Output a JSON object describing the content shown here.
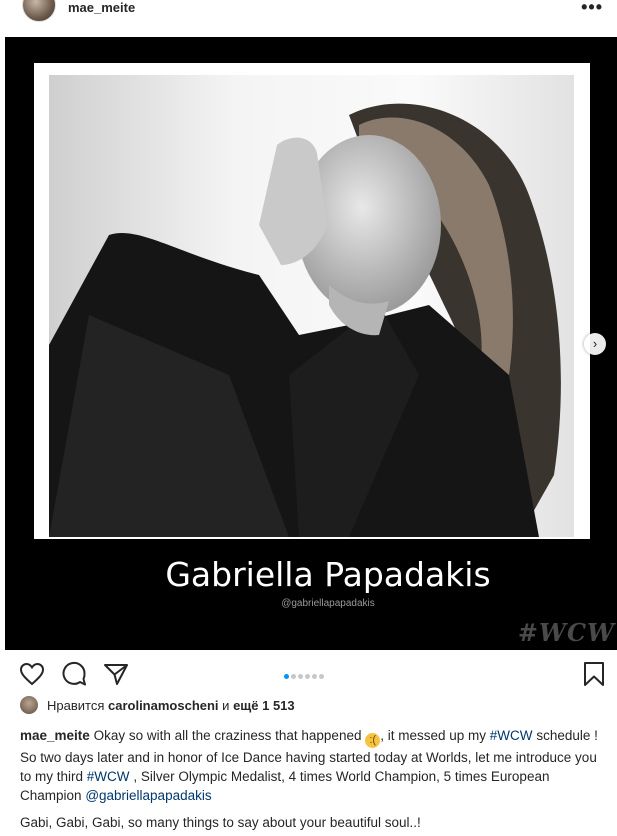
{
  "header": {
    "username": "mae_meite",
    "more_icon": "•••"
  },
  "post_image": {
    "name_caption": "Gabriella Papadakis",
    "handle_caption": "@gabriellapapadakis",
    "watermark": "#WCW",
    "next_icon": "›",
    "carousel_count": 6,
    "carousel_active_index": 0
  },
  "likes": {
    "prefix": "Нравится",
    "user": "carolinamoscheni",
    "middle": "и",
    "count": "ещё 1 513"
  },
  "caption": {
    "username": "mae_meite",
    "text_1": "Okay so with all the craziness that happened",
    "emoji": "😥",
    "text_2": ", it messed up my",
    "hashtag_1": "#WCW",
    "text_3": "schedule ! So two days later and in honor of Ice Dance having started today at Worlds, let me introduce you to my third",
    "hashtag_2": "#WCW",
    "text_4": ", Silver Olympic Medalist, 4 times World Champion, 5 times European Champion",
    "mention": "@gabriellapapadakis",
    "paragraph_2": "Gabi, Gabi, Gabi, so many things to say about your beautiful soul..!"
  }
}
